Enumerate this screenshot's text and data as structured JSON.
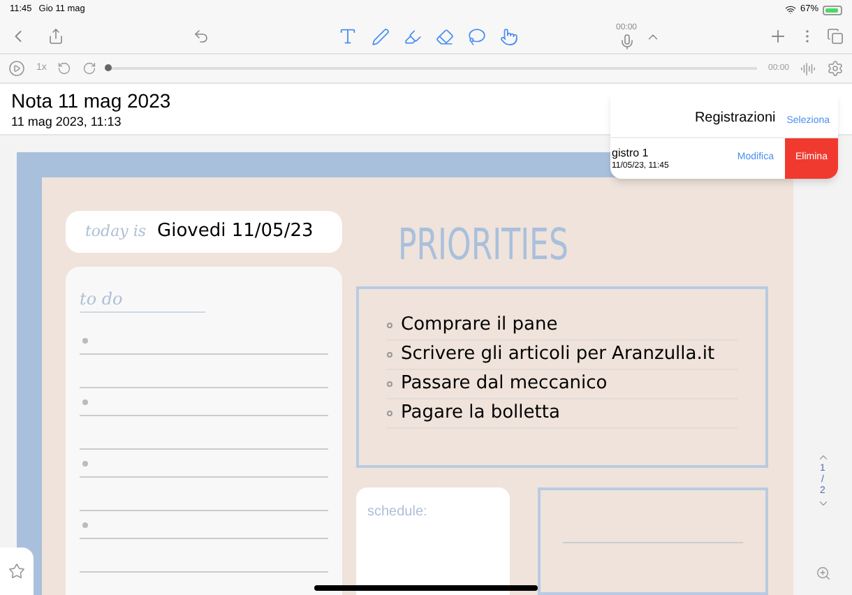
{
  "status_bar": {
    "time": "11:45",
    "date": "Gio 11 mag",
    "battery": "67%"
  },
  "toolbar": {
    "recording_time": "00:00"
  },
  "audio_bar": {
    "speed": "1x",
    "time": "00:00",
    "level": 0
  },
  "note": {
    "title": "Nota 11 mag 2023",
    "date": "11 mag 2023, 11:13"
  },
  "recordings_popover": {
    "title": "Registrazioni",
    "select_label": "Seleziona",
    "recording": {
      "name": "gistro 1",
      "date": "11/05/23, 11:45"
    },
    "edit_label": "Modifica",
    "delete_label": "Elimina"
  },
  "planner": {
    "today_label": "today is",
    "date": "Giovedi 11/05/23",
    "todo_label": "to do",
    "priorities_title": "PRIORITIES",
    "priorities": [
      "Comprare il pane",
      "Scrivere gli articoli per Aranzulla.it",
      "Passare dal meccanico",
      "Pagare la bolletta"
    ],
    "schedule_label": "schedule:"
  },
  "page_nav": {
    "current": "1",
    "separator": "/",
    "total": "2"
  }
}
